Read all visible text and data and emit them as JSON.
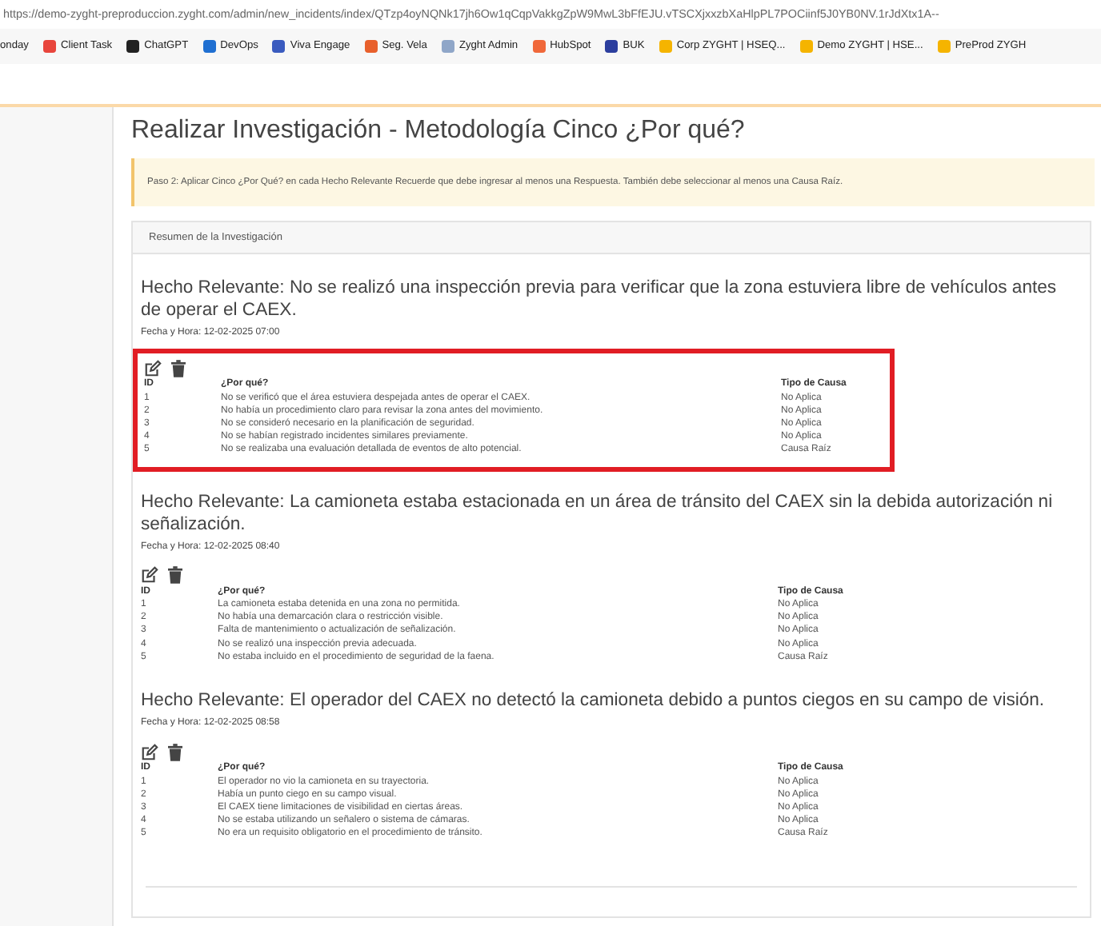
{
  "browser": {
    "url": "https://demo-zyght-preproduccion.zyght.com/admin/new_incidents/index/QTzp4oyNQNk17jh6Ow1qCqpVakkgZpW9MwL3bFfEJU.vTSCXjxxzbXaHlpPL7POCiinf5J0YB0NV.1rJdXtx1A--",
    "bookmarks": [
      "onday",
      "Client Task",
      "ChatGPT",
      "DevOps",
      "Viva Engage",
      "Seg. Vela",
      "Zyght Admin",
      "HubSpot",
      "BUK",
      "Corp ZYGHT | HSEQ...",
      "Demo ZYGHT | HSE...",
      "PreProd ZYGH"
    ]
  },
  "page": {
    "title": "Realizar Investigación - Metodología Cinco ¿Por qué?",
    "alert": "Paso 2: Aplicar Cinco ¿Por Qué? en cada Hecho Relevante Recuerde que debe ingresar al menos una Respuesta. También debe seleccionar al menos una Causa Raíz.",
    "card_title": "Resumen de la Investigación",
    "facts": [
      {
        "title": "Hecho Relevante: No se realizó una inspección previa para verificar que la zona estuviera libre de vehículos antes de operar el CAEX.",
        "datetime": "Fecha y Hora: 12-02-2025 07:00",
        "highlighted": true,
        "columns": [
          "ID",
          "¿Por qué?",
          "Tipo de Causa"
        ],
        "rows": [
          [
            "1",
            "No se verificó que el área estuviera despejada antes de operar el CAEX.",
            "No Aplica"
          ],
          [
            "2",
            "No había un procedimiento claro para revisar la zona antes del movimiento.",
            "No Aplica"
          ],
          [
            "3",
            "No se consideró necesario en la planificación de seguridad.",
            "No Aplica"
          ],
          [
            "4",
            "No se habían registrado incidentes similares previamente.",
            "No Aplica"
          ],
          [
            "5",
            "No se realizaba una evaluación detallada de eventos de alto potencial.",
            "Causa Raíz"
          ]
        ]
      },
      {
        "title": "Hecho Relevante: La camioneta estaba estacionada en un área de tránsito del CAEX sin la debida autorización ni señalización.",
        "datetime": "Fecha y Hora: 12-02-2025 08:40",
        "highlighted": false,
        "columns": [
          "ID",
          "¿Por qué?",
          "Tipo de Causa"
        ],
        "rows": [
          [
            "1",
            "La camioneta estaba detenida en una zona no permitida.",
            "No Aplica"
          ],
          [
            "2",
            "No había una demarcación clara o restricción visible.",
            "No Aplica"
          ],
          [
            "3",
            "Falta de mantenimiento o actualización de señalización.",
            "No Aplica"
          ],
          [
            "4",
            "No se realizó una inspección previa adecuada.",
            "No Aplica"
          ],
          [
            "5",
            "No estaba incluido en el procedimiento de seguridad de la faena.",
            "Causa Raíz"
          ]
        ]
      },
      {
        "title": "Hecho Relevante: El operador del CAEX no detectó la camioneta debido a puntos ciegos en su campo de visión.",
        "datetime": "Fecha y Hora: 12-02-2025 08:58",
        "highlighted": false,
        "columns": [
          "ID",
          "¿Por qué?",
          "Tipo de Causa"
        ],
        "rows": [
          [
            "1",
            "El operador no vio la camioneta en su trayectoria.",
            "No Aplica"
          ],
          [
            "2",
            "Había un punto ciego en su campo visual.",
            "No Aplica"
          ],
          [
            "3",
            "El CAEX tiene limitaciones de visibilidad en ciertas áreas.",
            "No Aplica"
          ],
          [
            "4",
            "No se estaba utilizando un señalero o sistema de cámaras.",
            "No Aplica"
          ],
          [
            "5",
            "No era un requisito obligatorio en el procedimiento de tránsito.",
            "Causa Raíz"
          ]
        ]
      }
    ]
  }
}
